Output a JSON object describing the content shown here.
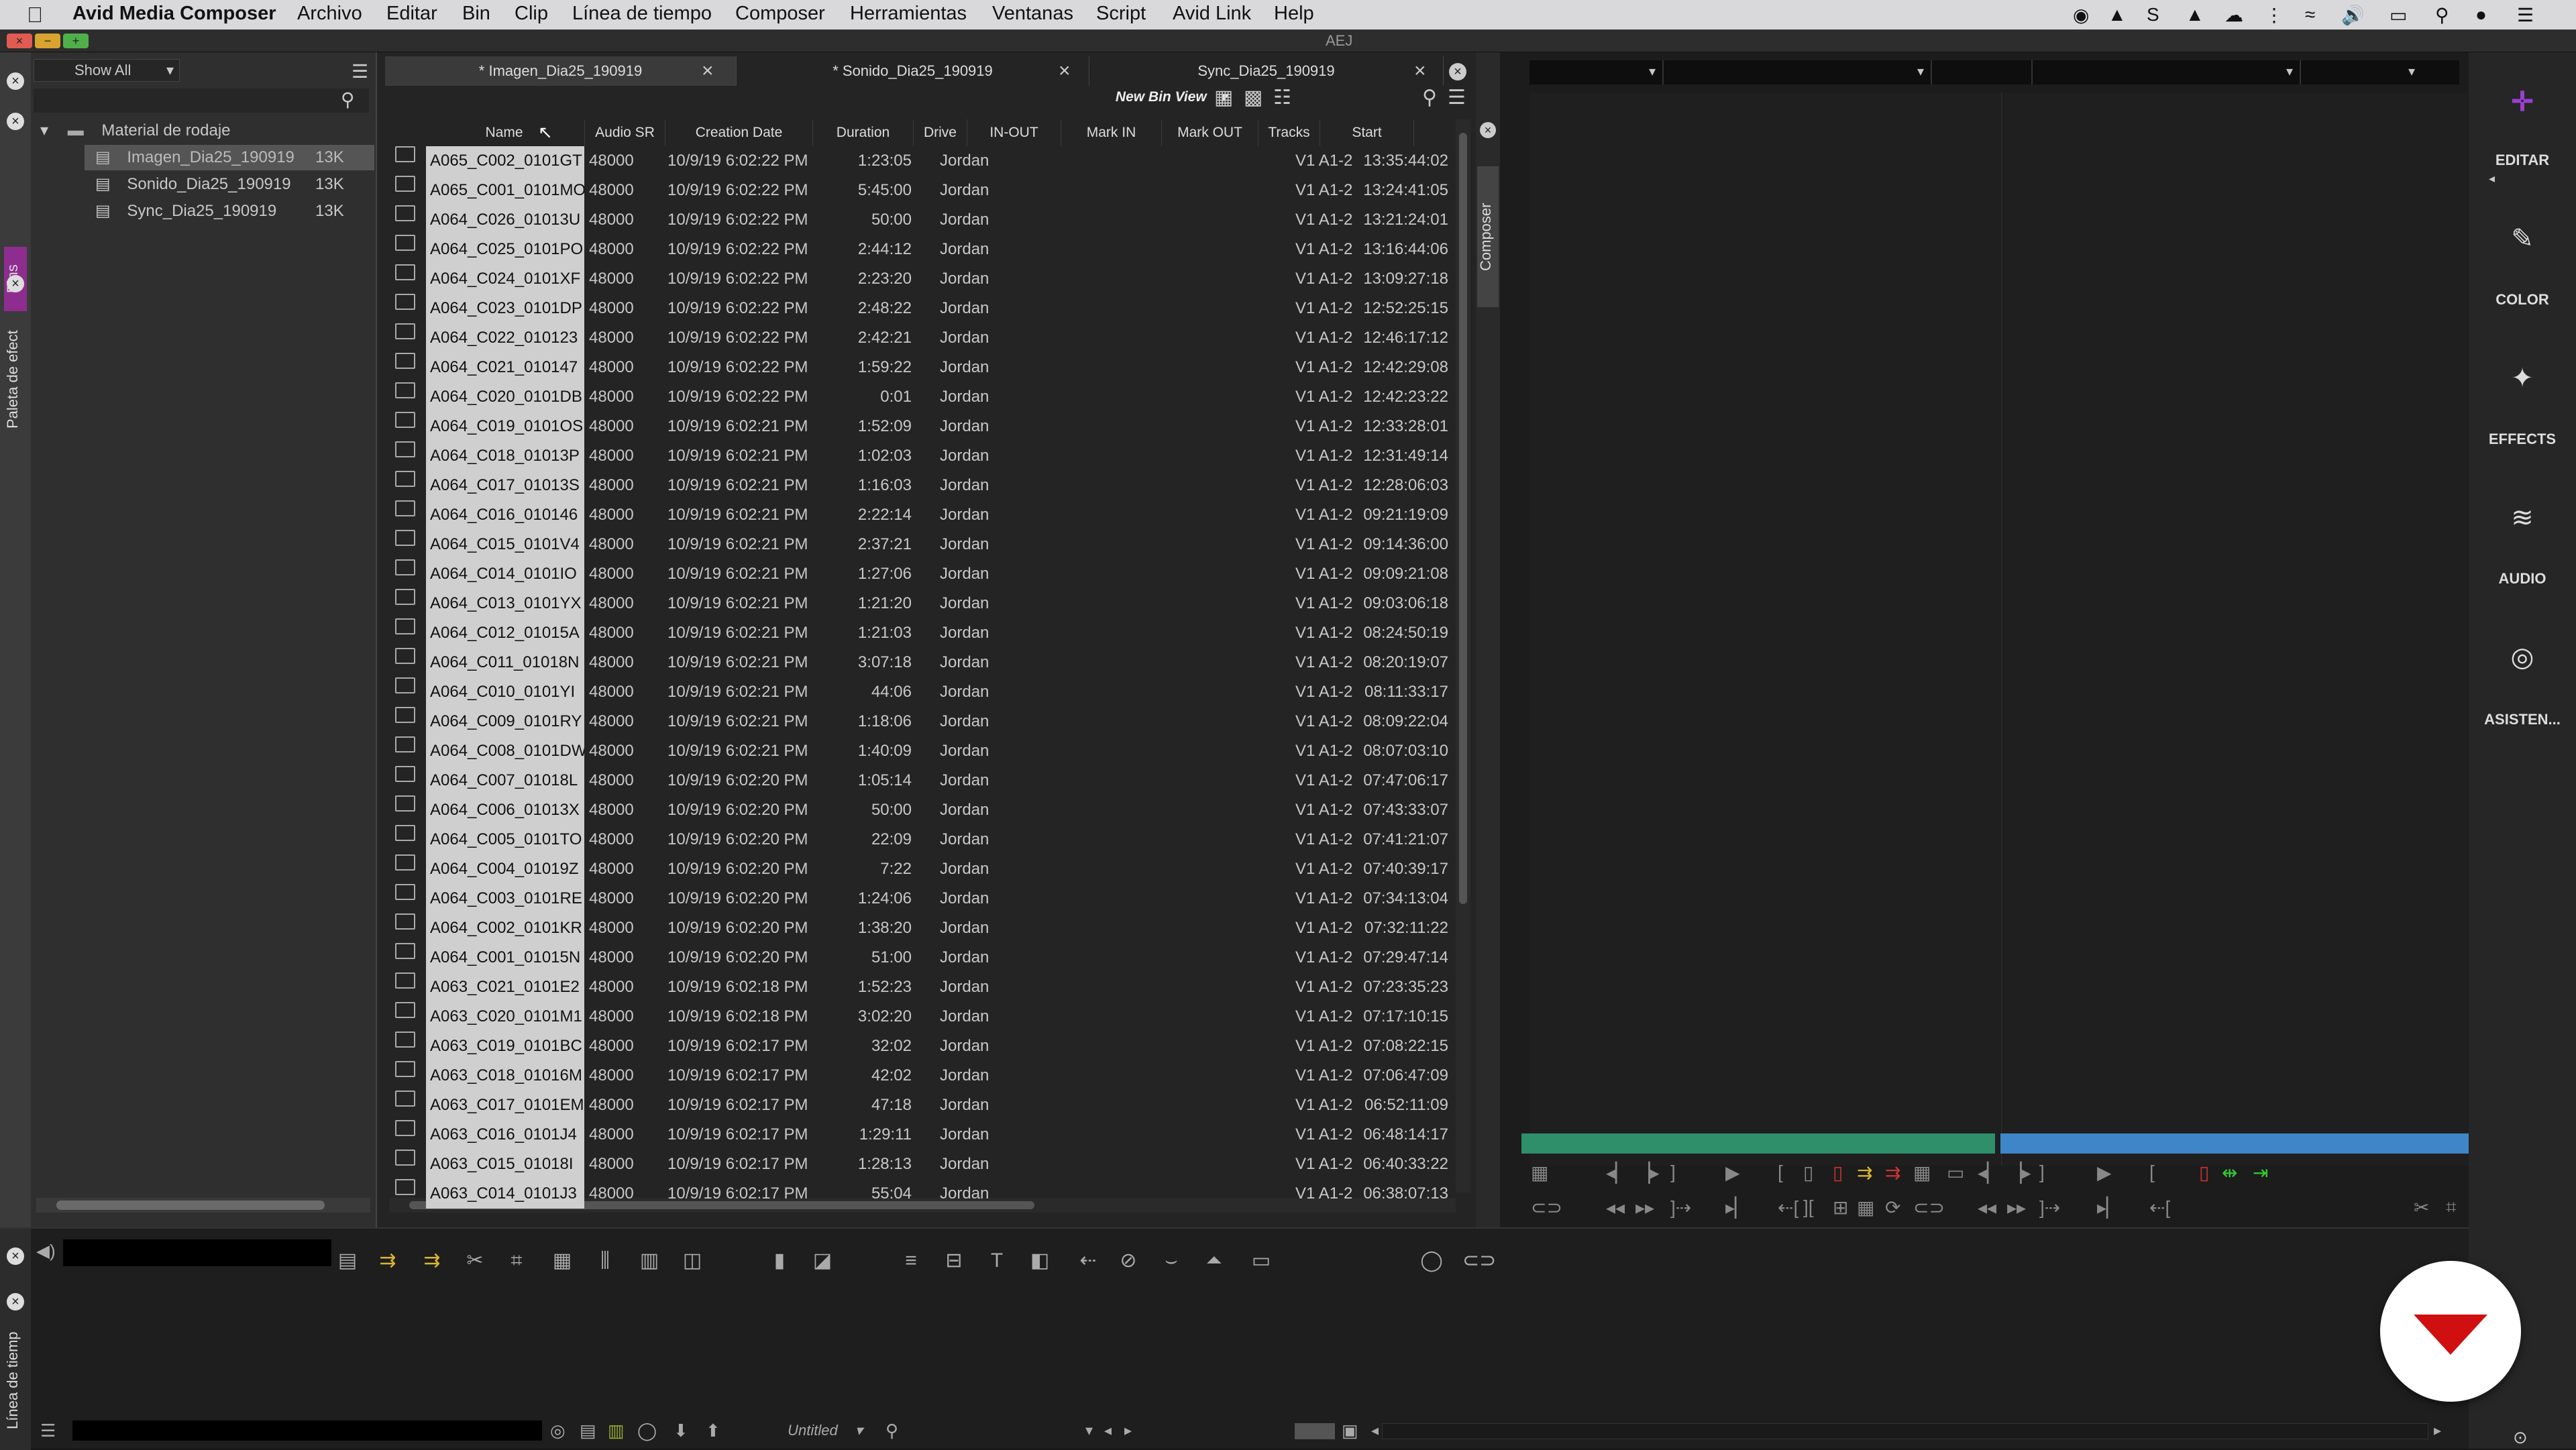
{
  "menubar": {
    "apple_icon": "apple-icon",
    "app_name": "Avid Media Composer",
    "items": [
      "Archivo",
      "Editar",
      "Bin",
      "Clip",
      "Línea de tiempo",
      "Composer",
      "Herramientas",
      "Ventanas",
      "Script",
      "Avid Link",
      "Help"
    ]
  },
  "window": {
    "title": "AEJ"
  },
  "left_strip": {
    "bins_tab": "Bins",
    "effects_tab": "Paleta de efect",
    "timeline_tab": "Línea de tiemp"
  },
  "bins_panel": {
    "filter": "Show All",
    "folder": "Material de rodaje",
    "bins": [
      {
        "name": "Imagen_Dia25_190919",
        "size": "13K"
      },
      {
        "name": "Sonido_Dia25_190919",
        "size": "13K"
      },
      {
        "name": "Sync_Dia25_190919",
        "size": "13K"
      }
    ]
  },
  "bin_window": {
    "tabs": [
      "* Imagen_Dia25_190919",
      "* Sonido_Dia25_190919",
      "Sync_Dia25_190919"
    ],
    "bin_view": "New Bin View",
    "columns": [
      "Name",
      "Audio SR",
      "Creation Date",
      "Duration",
      "Drive",
      "IN-OUT",
      "Mark IN",
      "Mark OUT",
      "Tracks",
      "Start"
    ],
    "rows": [
      [
        "A065_C002_0101GT",
        "48000",
        "10/9/19 6:02:22 PM",
        "1:23:05",
        "Jordan",
        "V1 A1-2",
        "13:35:44:02"
      ],
      [
        "A065_C001_0101MO",
        "48000",
        "10/9/19 6:02:22 PM",
        "5:45:00",
        "Jordan",
        "V1 A1-2",
        "13:24:41:05"
      ],
      [
        "A064_C026_01013U",
        "48000",
        "10/9/19 6:02:22 PM",
        "50:00",
        "Jordan",
        "V1 A1-2",
        "13:21:24:01"
      ],
      [
        "A064_C025_0101PO",
        "48000",
        "10/9/19 6:02:22 PM",
        "2:44:12",
        "Jordan",
        "V1 A1-2",
        "13:16:44:06"
      ],
      [
        "A064_C024_0101XF",
        "48000",
        "10/9/19 6:02:22 PM",
        "2:23:20",
        "Jordan",
        "V1 A1-2",
        "13:09:27:18"
      ],
      [
        "A064_C023_0101DP",
        "48000",
        "10/9/19 6:02:22 PM",
        "2:48:22",
        "Jordan",
        "V1 A1-2",
        "12:52:25:15"
      ],
      [
        "A064_C022_010123",
        "48000",
        "10/9/19 6:02:22 PM",
        "2:42:21",
        "Jordan",
        "V1 A1-2",
        "12:46:17:12"
      ],
      [
        "A064_C021_010147",
        "48000",
        "10/9/19 6:02:22 PM",
        "1:59:22",
        "Jordan",
        "V1 A1-2",
        "12:42:29:08"
      ],
      [
        "A064_C020_0101DB",
        "48000",
        "10/9/19 6:02:22 PM",
        "0:01",
        "Jordan",
        "V1 A1-2",
        "12:42:23:22"
      ],
      [
        "A064_C019_0101OS",
        "48000",
        "10/9/19 6:02:21 PM",
        "1:52:09",
        "Jordan",
        "V1 A1-2",
        "12:33:28:01"
      ],
      [
        "A064_C018_01013P",
        "48000",
        "10/9/19 6:02:21 PM",
        "1:02:03",
        "Jordan",
        "V1 A1-2",
        "12:31:49:14"
      ],
      [
        "A064_C017_01013S",
        "48000",
        "10/9/19 6:02:21 PM",
        "1:16:03",
        "Jordan",
        "V1 A1-2",
        "12:28:06:03"
      ],
      [
        "A064_C016_010146",
        "48000",
        "10/9/19 6:02:21 PM",
        "2:22:14",
        "Jordan",
        "V1 A1-2",
        "09:21:19:09"
      ],
      [
        "A064_C015_0101V4",
        "48000",
        "10/9/19 6:02:21 PM",
        "2:37:21",
        "Jordan",
        "V1 A1-2",
        "09:14:36:00"
      ],
      [
        "A064_C014_0101IO",
        "48000",
        "10/9/19 6:02:21 PM",
        "1:27:06",
        "Jordan",
        "V1 A1-2",
        "09:09:21:08"
      ],
      [
        "A064_C013_0101YX",
        "48000",
        "10/9/19 6:02:21 PM",
        "1:21:20",
        "Jordan",
        "V1 A1-2",
        "09:03:06:18"
      ],
      [
        "A064_C012_01015A",
        "48000",
        "10/9/19 6:02:21 PM",
        "1:21:03",
        "Jordan",
        "V1 A1-2",
        "08:24:50:19"
      ],
      [
        "A064_C011_01018N",
        "48000",
        "10/9/19 6:02:21 PM",
        "3:07:18",
        "Jordan",
        "V1 A1-2",
        "08:20:19:07"
      ],
      [
        "A064_C010_0101YI",
        "48000",
        "10/9/19 6:02:21 PM",
        "44:06",
        "Jordan",
        "V1 A1-2",
        "08:11:33:17"
      ],
      [
        "A064_C009_0101RY",
        "48000",
        "10/9/19 6:02:21 PM",
        "1:18:06",
        "Jordan",
        "V1 A1-2",
        "08:09:22:04"
      ],
      [
        "A064_C008_0101DW",
        "48000",
        "10/9/19 6:02:21 PM",
        "1:40:09",
        "Jordan",
        "V1 A1-2",
        "08:07:03:10"
      ],
      [
        "A064_C007_01018L",
        "48000",
        "10/9/19 6:02:20 PM",
        "1:05:14",
        "Jordan",
        "V1 A1-2",
        "07:47:06:17"
      ],
      [
        "A064_C006_01013X",
        "48000",
        "10/9/19 6:02:20 PM",
        "50:00",
        "Jordan",
        "V1 A1-2",
        "07:43:33:07"
      ],
      [
        "A064_C005_0101TO",
        "48000",
        "10/9/19 6:02:20 PM",
        "22:09",
        "Jordan",
        "V1 A1-2",
        "07:41:21:07"
      ],
      [
        "A064_C004_01019Z",
        "48000",
        "10/9/19 6:02:20 PM",
        "7:22",
        "Jordan",
        "V1 A1-2",
        "07:40:39:17"
      ],
      [
        "A064_C003_0101RE",
        "48000",
        "10/9/19 6:02:20 PM",
        "1:24:06",
        "Jordan",
        "V1 A1-2",
        "07:34:13:04"
      ],
      [
        "A064_C002_0101KR",
        "48000",
        "10/9/19 6:02:20 PM",
        "1:38:20",
        "Jordan",
        "V1 A1-2",
        "07:32:11:22"
      ],
      [
        "A064_C001_01015N",
        "48000",
        "10/9/19 6:02:20 PM",
        "51:00",
        "Jordan",
        "V1 A1-2",
        "07:29:47:14"
      ],
      [
        "A063_C021_0101E2",
        "48000",
        "10/9/19 6:02:18 PM",
        "1:52:23",
        "Jordan",
        "V1 A1-2",
        "07:23:35:23"
      ],
      [
        "A063_C020_0101M1",
        "48000",
        "10/9/19 6:02:18 PM",
        "3:02:20",
        "Jordan",
        "V1 A1-2",
        "07:17:10:15"
      ],
      [
        "A063_C019_0101BC",
        "48000",
        "10/9/19 6:02:17 PM",
        "32:02",
        "Jordan",
        "V1 A1-2",
        "07:08:22:15"
      ],
      [
        "A063_C018_01016M",
        "48000",
        "10/9/19 6:02:17 PM",
        "42:02",
        "Jordan",
        "V1 A1-2",
        "07:06:47:09"
      ],
      [
        "A063_C017_0101EM",
        "48000",
        "10/9/19 6:02:17 PM",
        "47:18",
        "Jordan",
        "V1 A1-2",
        "06:52:11:09"
      ],
      [
        "A063_C016_0101J4",
        "48000",
        "10/9/19 6:02:17 PM",
        "1:29:11",
        "Jordan",
        "V1 A1-2",
        "06:48:14:17"
      ],
      [
        "A063_C015_01018I",
        "48000",
        "10/9/19 6:02:17 PM",
        "1:28:13",
        "Jordan",
        "V1 A1-2",
        "06:40:33:22"
      ],
      [
        "A063_C014_0101J3",
        "48000",
        "10/9/19 6:02:17 PM",
        "55:04",
        "Jordan",
        "V1 A1-2",
        "06:38:07:13"
      ]
    ]
  },
  "composer": {
    "label": "Composer"
  },
  "right_bar": {
    "items": [
      "EDITAR",
      "COLOR",
      "EFFECTS",
      "AUDIO",
      "ASISTEN..."
    ]
  },
  "timeline": {
    "sequence": "Untitled"
  },
  "colors": {
    "accent_purple": "#9b3fd1",
    "green_bar": "#2f8f6a",
    "blue_bar": "#3f86c8",
    "brand_red": "#d01010"
  }
}
